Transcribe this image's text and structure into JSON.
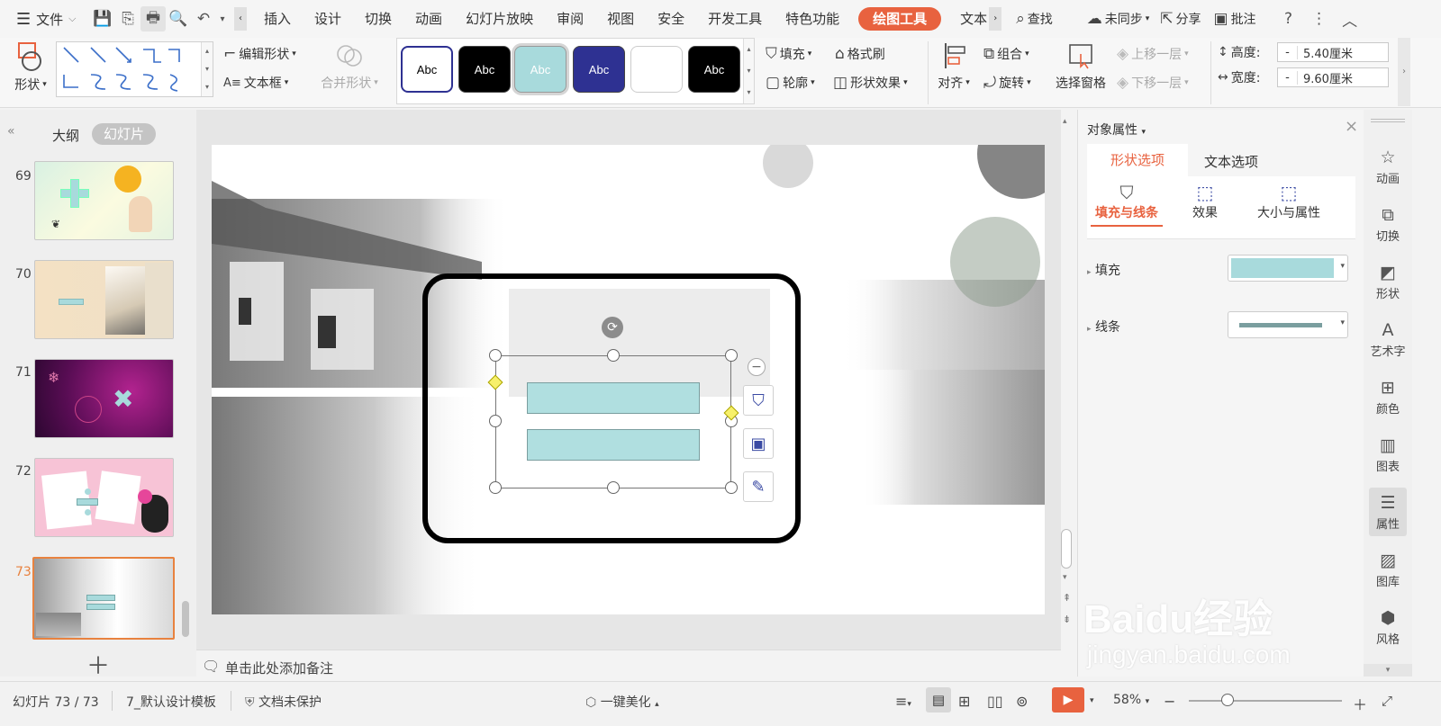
{
  "menubar": {
    "file_label": "文件",
    "tabs": [
      "插入",
      "设计",
      "切换",
      "动画",
      "幻灯片放映",
      "审阅",
      "视图",
      "安全",
      "开发工具",
      "特色功能"
    ],
    "active_tab": "绘图工具",
    "last_tab": "文本",
    "search_label": "查找",
    "sync_label": "未同步",
    "share_label": "分享",
    "comment_label": "批注"
  },
  "ribbon": {
    "shape_label": "形状",
    "edit_shape": "编辑形状",
    "text_box": "文本框",
    "merge_shape": "合并形状",
    "swatches": [
      {
        "label": "Abc",
        "bg": "#ffffff",
        "fg": "#000000"
      },
      {
        "label": "Abc",
        "bg": "#000000",
        "fg": "#ffffff"
      },
      {
        "label": "Abc",
        "bg": "#a8dadc",
        "fg": "#ffffff"
      },
      {
        "label": "Abc",
        "bg": "#2e3192",
        "fg": "#ffffff"
      },
      {
        "label": "",
        "bg": "#ffffff",
        "fg": "#000000"
      },
      {
        "label": "Abc",
        "bg": "#000000",
        "fg": "#ffffff"
      }
    ],
    "fill": "填充",
    "format_painter": "格式刷",
    "outline": "轮廓",
    "shape_effect": "形状效果",
    "align": "对齐",
    "group": "组合",
    "rotate": "旋转",
    "selection_pane": "选择窗格",
    "bring_forward": "上移一层",
    "send_backward": "下移一层",
    "height_label": "高度:",
    "height_value": "5.40厘米",
    "width_label": "宽度:",
    "width_value": "9.60厘米"
  },
  "leftpanel": {
    "outline_tab": "大纲",
    "slides_tab": "幻灯片",
    "thumbs": [
      {
        "num": "69"
      },
      {
        "num": "70"
      },
      {
        "num": "71"
      },
      {
        "num": "72"
      },
      {
        "num": "73"
      }
    ]
  },
  "notes_placeholder": "单击此处添加备注",
  "rightpanel": {
    "title": "对象属性",
    "tab_shape": "形状选项",
    "tab_text": "文本选项",
    "sub_fill_line": "填充与线条",
    "sub_effect": "效果",
    "sub_size": "大小与属性",
    "fill_label": "填充",
    "line_label": "线条",
    "fill_color": "#a8dadc",
    "line_color": "#7a9e9f"
  },
  "sidebar": [
    "动画",
    "切换",
    "形状",
    "艺术字",
    "颜色",
    "图表",
    "属性",
    "图库",
    "风格"
  ],
  "watermark": {
    "brand": "Baidu经验",
    "url": "jingyan.baidu.com"
  },
  "statusbar": {
    "slide_info": "幻灯片 73 / 73",
    "template": "7_默认设计模板",
    "protect": "文档未保护",
    "beautify": "一键美化",
    "zoom": "58%"
  },
  "colors": {
    "accent": "#e8623f",
    "active_slide_border": "#e8823f"
  }
}
